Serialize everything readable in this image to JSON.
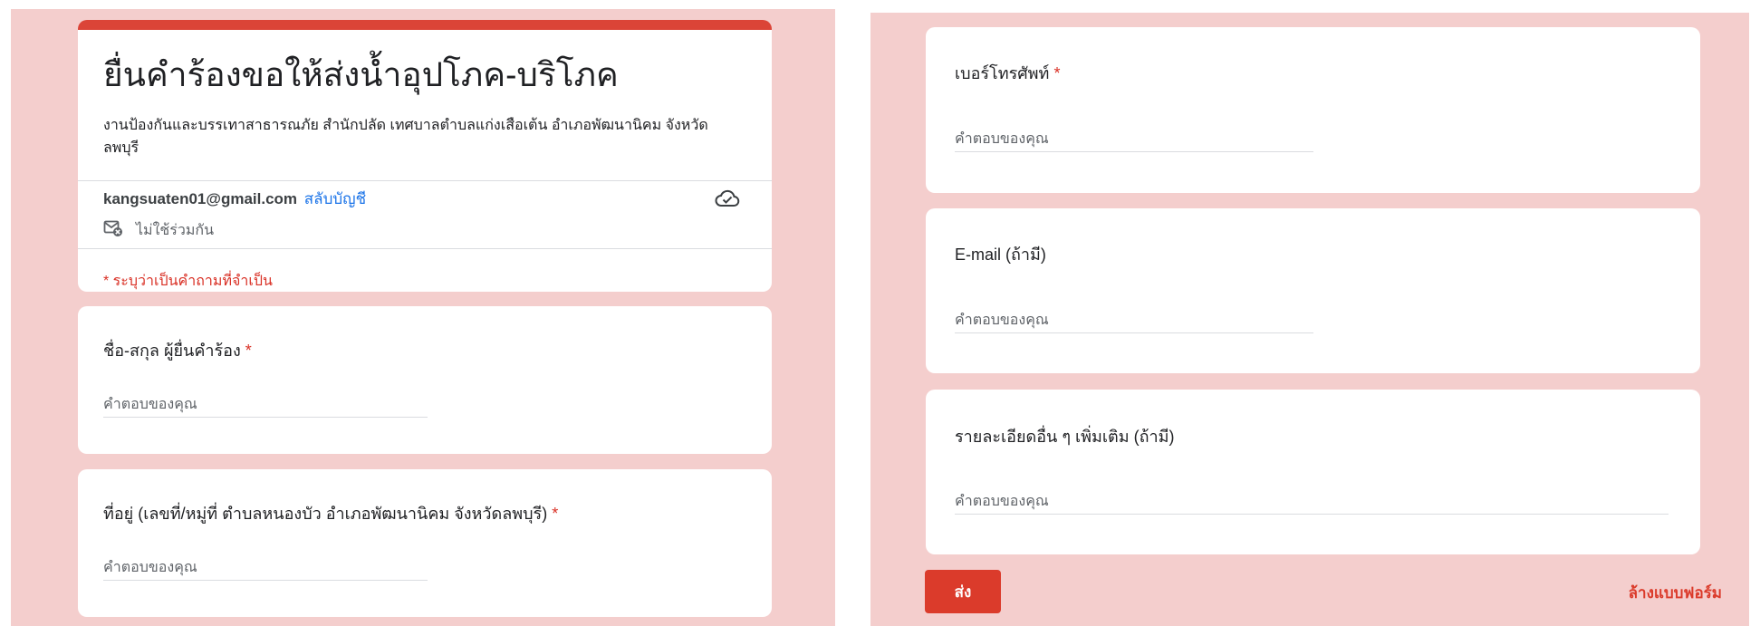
{
  "form": {
    "title": "ยื่นคำร้องขอให้ส่งน้ำอุปโภค-บริโภค",
    "description": "งานป้องกันและบรรเทาสาธารณภัย สำนักปลัด เทศบาลตำบลแก่งเสือเต้น อำเภอพัฒนานิคม จังหวัดลพบุรี",
    "account_email": "kangsuaten01@gmail.com",
    "switch_account": "สลับบัญชี",
    "not_shared": "ไม่ใช้ร่วมกัน",
    "required_note": "* ระบุว่าเป็นคำถามที่จำเป็น"
  },
  "questions": [
    {
      "label": "ชื่อ-สกุล ผู้ยื่นคำร้อง",
      "required_mark": "*",
      "placeholder": "คำตอบของคุณ"
    },
    {
      "label": "ที่อยู่ (เลขที่/หมู่ที่ ตำบลหนองบัว อำเภอพัฒนานิคม จังหวัดลพบุรี)",
      "required_mark": "*",
      "placeholder": "คำตอบของคุณ"
    },
    {
      "label": "เบอร์โทรศัพท์",
      "required_mark": "*",
      "placeholder": "คำตอบของคุณ"
    },
    {
      "label": "E-mail (ถ้ามี)",
      "placeholder": "คำตอบของคุณ"
    },
    {
      "label": "รายละเอียดอื่น ๆ เพิ่มเติม (ถ้ามี)",
      "placeholder": "คำตอบของคุณ"
    }
  ],
  "actions": {
    "submit": "ส่ง",
    "clear": "ล้างแบบฟอร์ม"
  },
  "colors": {
    "page_background": "#f4cecd",
    "accent": "#db4437",
    "link": "#1a73e8",
    "required": "#d93025"
  },
  "icons": [
    "cloud-check-icon",
    "mail-off-icon"
  ]
}
